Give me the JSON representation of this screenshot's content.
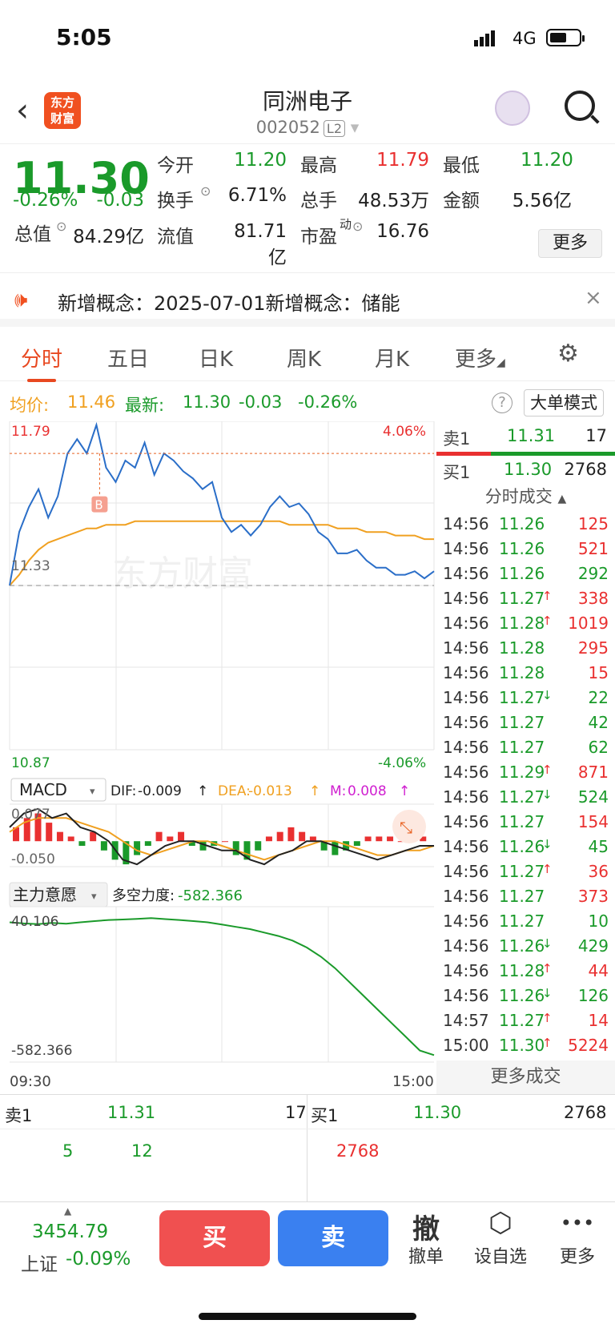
{
  "status": {
    "time": "5:05",
    "network": "4G"
  },
  "nav": {
    "back": "‹",
    "logo": "东方\n财富",
    "title": "同洲电子",
    "code": "002052",
    "level": "L2",
    "dropdown": "▾"
  },
  "quote": {
    "price": "11.30",
    "pct": "-0.26%",
    "chg": "-0.03",
    "open_label": "今开",
    "open": "11.20",
    "high_label": "最高",
    "high": "11.79",
    "low_label": "最低",
    "low": "11.20",
    "turn_label": "换手",
    "turn": "6.71%",
    "vol_label": "总手",
    "vol": "48.53万",
    "amt_label": "金额",
    "amt": "5.56亿",
    "mcap_label": "总值",
    "mcap": "84.29亿",
    "fcap_label": "流值",
    "fcap": "81.71亿",
    "pe_label": "市盈",
    "pe_sup": "动",
    "pe": "16.76",
    "more": "更多"
  },
  "notice": {
    "text": "新增概念：2025-07-01新增概念：储能",
    "close": "×"
  },
  "tabs": [
    "分时",
    "五日",
    "日K",
    "周K",
    "月K",
    "更多"
  ],
  "legend": {
    "avg_label": "均价:",
    "avg": "11.46",
    "last_label": "最新:",
    "last": "11.30",
    "chg": "-0.03",
    "pct": "-0.26%",
    "help": "?",
    "mode": "大单模式"
  },
  "chart_data": {
    "type": "line",
    "price_axis": {
      "max": "11.79",
      "max_pct": "4.06%",
      "min": "10.87",
      "min_pct": "-4.06%",
      "ref": "11.33"
    },
    "time_axis": {
      "start": "09:30",
      "end": "15:00"
    },
    "buy_marker": "B",
    "watermark": "东方财富",
    "price": [
      11.33,
      11.48,
      11.55,
      11.6,
      11.52,
      11.58,
      11.7,
      11.74,
      11.7,
      11.78,
      11.66,
      11.62,
      11.68,
      11.66,
      11.73,
      11.64,
      11.7,
      11.68,
      11.65,
      11.63,
      11.6,
      11.62,
      11.52,
      11.48,
      11.5,
      11.47,
      11.5,
      11.55,
      11.58,
      11.55,
      11.56,
      11.53,
      11.48,
      11.46,
      11.42,
      11.42,
      11.43,
      11.4,
      11.38,
      11.38,
      11.36,
      11.36,
      11.37,
      11.35,
      11.37
    ],
    "avg": [
      11.33,
      11.36,
      11.4,
      11.43,
      11.45,
      11.46,
      11.47,
      11.48,
      11.49,
      11.49,
      11.5,
      11.5,
      11.5,
      11.51,
      11.51,
      11.51,
      11.51,
      11.51,
      11.51,
      11.51,
      11.51,
      11.51,
      11.51,
      11.51,
      11.51,
      11.51,
      11.51,
      11.51,
      11.51,
      11.5,
      11.5,
      11.5,
      11.5,
      11.5,
      11.49,
      11.49,
      11.49,
      11.48,
      11.48,
      11.48,
      11.47,
      11.47,
      11.47,
      11.46,
      11.46
    ],
    "macd": {
      "label": "MACD",
      "dif_label": "DIF:",
      "dif": "-0.009",
      "dea_label": "DEA:",
      "dea": "-0.013",
      "m_label": "M:",
      "m": "0.008",
      "arrow": "↑",
      "top": "0.077",
      "bottom": "-0.050",
      "hist": [
        0.03,
        0.05,
        0.06,
        0.04,
        0.02,
        0.01,
        -0.01,
        0.02,
        -0.02,
        -0.04,
        -0.05,
        -0.03,
        -0.01,
        0.02,
        0.01,
        0.02,
        -0.01,
        -0.02,
        -0.01,
        0.0,
        -0.03,
        -0.04,
        -0.02,
        0.01,
        0.02,
        0.03,
        0.02,
        0.01,
        -0.02,
        -0.03,
        -0.02,
        -0.01,
        0.01,
        0.01,
        0.01,
        0.0,
        0.01,
        0.01
      ],
      "dif_line": [
        0.03,
        0.06,
        0.07,
        0.05,
        0.06,
        0.03,
        0.02,
        0.0,
        -0.04,
        -0.05,
        -0.03,
        -0.01,
        0.0,
        0.0,
        -0.01,
        -0.02,
        -0.02,
        -0.04,
        -0.05,
        -0.03,
        -0.02,
        0.0,
        0.0,
        -0.01,
        -0.02,
        -0.03,
        -0.04,
        -0.03,
        -0.02,
        -0.01,
        -0.01
      ],
      "dea_line": [
        0.02,
        0.04,
        0.05,
        0.05,
        0.05,
        0.04,
        0.03,
        0.02,
        0.0,
        -0.02,
        -0.03,
        -0.02,
        -0.01,
        0.0,
        0.0,
        -0.01,
        -0.02,
        -0.03,
        -0.04,
        -0.03,
        -0.02,
        -0.01,
        0.0,
        0.0,
        -0.01,
        -0.02,
        -0.03,
        -0.03,
        -0.02,
        -0.02,
        -0.01
      ]
    },
    "flow": {
      "label": "主力意愿",
      "value_label": "多空力度:",
      "value": "-582.366",
      "top": "40.106",
      "bottom": "-582.366",
      "line": [
        0,
        -5,
        -8,
        -3,
        -6,
        0,
        5,
        10,
        12,
        15,
        18,
        14,
        10,
        5,
        0,
        -10,
        -20,
        -30,
        -45,
        -60,
        -80,
        -110,
        -150,
        -200,
        -260,
        -320,
        -380,
        -440,
        -500,
        -560,
        -580
      ]
    }
  },
  "orderbook": {
    "sell_label": "卖1",
    "sell_price": "11.31",
    "sell_vol": "17",
    "buy_label": "买1",
    "buy_price": "11.30",
    "buy_vol": "2768"
  },
  "ticks_title": "分时成交",
  "ticks": [
    [
      "14:56",
      "11.26",
      "",
      "125",
      "red",
      "green"
    ],
    [
      "14:56",
      "11.26",
      "",
      "521",
      "red",
      "green"
    ],
    [
      "14:56",
      "11.26",
      "",
      "292",
      "green",
      "green"
    ],
    [
      "14:56",
      "11.27",
      "↑",
      "338",
      "red",
      "green"
    ],
    [
      "14:56",
      "11.28",
      "↑",
      "1019",
      "red",
      "green"
    ],
    [
      "14:56",
      "11.28",
      "",
      "295",
      "red",
      "green"
    ],
    [
      "14:56",
      "11.28",
      "",
      "15",
      "red",
      "green"
    ],
    [
      "14:56",
      "11.27",
      "↓",
      "22",
      "green",
      "green"
    ],
    [
      "14:56",
      "11.27",
      "",
      "42",
      "green",
      "green"
    ],
    [
      "14:56",
      "11.27",
      "",
      "62",
      "green",
      "green"
    ],
    [
      "14:56",
      "11.29",
      "↑",
      "871",
      "red",
      "green"
    ],
    [
      "14:56",
      "11.27",
      "↓",
      "524",
      "green",
      "green"
    ],
    [
      "14:56",
      "11.27",
      "",
      "154",
      "red",
      "green"
    ],
    [
      "14:56",
      "11.26",
      "↓",
      "45",
      "green",
      "green"
    ],
    [
      "14:56",
      "11.27",
      "↑",
      "36",
      "red",
      "green"
    ],
    [
      "14:56",
      "11.27",
      "",
      "373",
      "red",
      "green"
    ],
    [
      "14:56",
      "11.27",
      "",
      "10",
      "green",
      "green"
    ],
    [
      "14:56",
      "11.26",
      "↓",
      "429",
      "green",
      "green"
    ],
    [
      "14:56",
      "11.28",
      "↑",
      "44",
      "red",
      "green"
    ],
    [
      "14:56",
      "11.26",
      "↓",
      "126",
      "green",
      "green"
    ],
    [
      "14:57",
      "11.27",
      "↑",
      "14",
      "red",
      "green"
    ],
    [
      "15:00",
      "11.30",
      "↑",
      "5224",
      "red",
      "green"
    ]
  ],
  "more_ticks": "更多成交",
  "depth": {
    "sell_label": "卖1",
    "sell_price": "11.31",
    "sell_vol": "17",
    "buy_label": "买1",
    "buy_price": "11.30",
    "buy_vol": "2768",
    "sell_q1": "5",
    "sell_q2": "12",
    "buy_q1": "2768"
  },
  "bottom": {
    "index_value": "3454.79",
    "index_name": "上证",
    "index_pct": "-0.09%",
    "buy": "买",
    "sell": "卖",
    "cancel_icon": "撤",
    "cancel": "撤单",
    "fav": "设自选",
    "more": "更多",
    "more_icon": "•••"
  },
  "colors": {
    "up": "#e93030",
    "down": "#1a9a2a",
    "accent": "#e84820",
    "buy_btn": "#f05050",
    "sell_btn": "#3a80f0",
    "price_line": "#2a6ec8",
    "avg_line": "#f0a020"
  }
}
